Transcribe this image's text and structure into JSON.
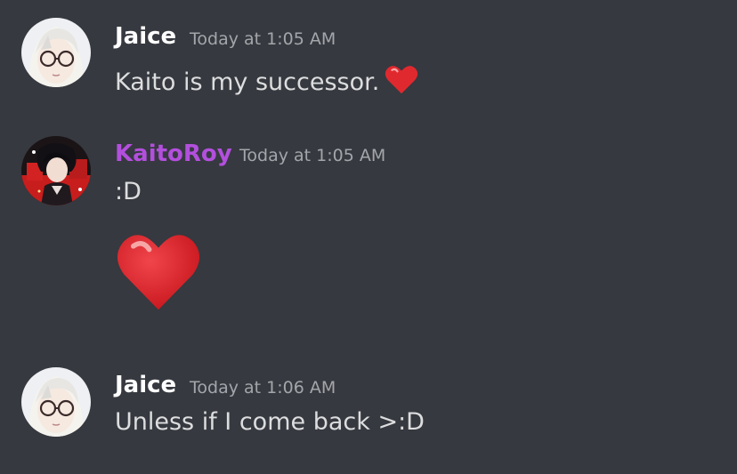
{
  "messages": [
    {
      "author": "Jaice",
      "author_color": "#ffffff",
      "timestamp": "Today at 1:05 AM",
      "text": "Kaito is my successor.",
      "inline_emoji": "heart-emoji"
    },
    {
      "author": "KaitoRoy",
      "author_color": "#b34fdd",
      "timestamp": "Today at 1:05 AM",
      "text": ":D",
      "jumbo_emoji": "heart-emoji"
    },
    {
      "author": "Jaice",
      "author_color": "#ffffff",
      "timestamp": "Today at 1:06 AM",
      "text": "Unless if I come back >:D"
    }
  ],
  "colors": {
    "background": "#36393f",
    "timestamp": "#a3a6aa",
    "heart": "#e0292f"
  }
}
